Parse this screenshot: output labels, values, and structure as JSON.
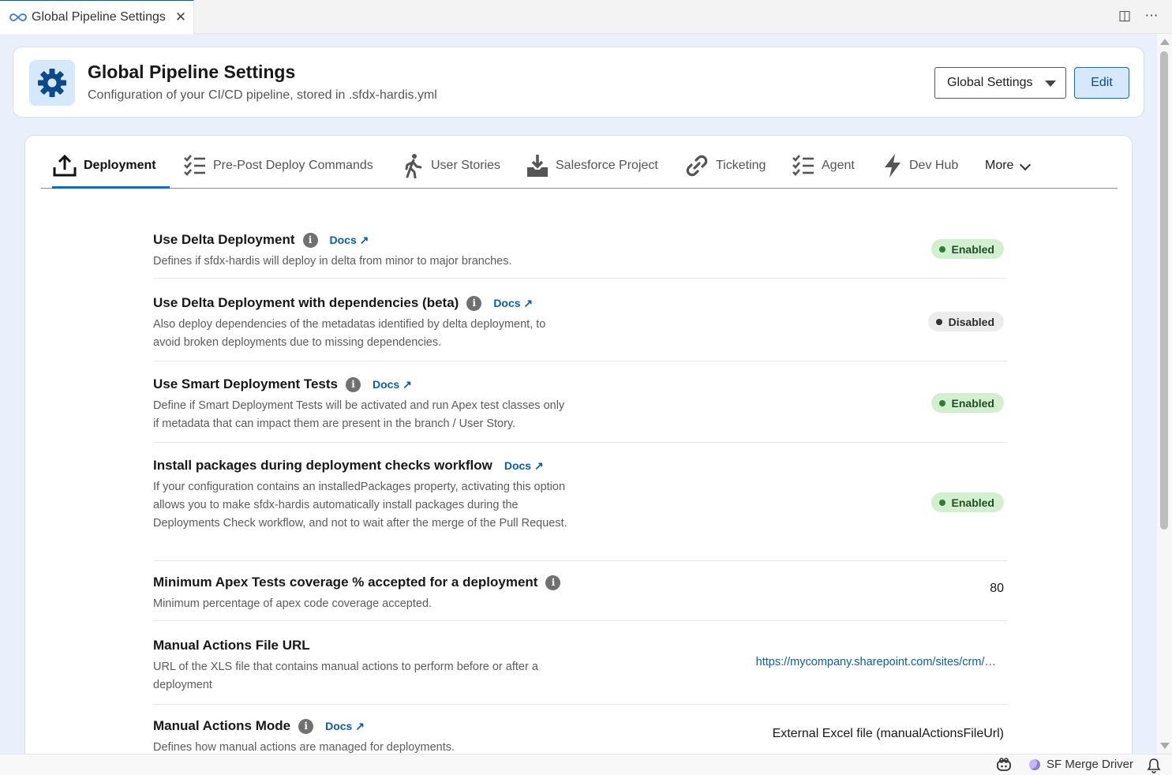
{
  "editor": {
    "tab_title": "Global Pipeline Settings",
    "close_glyph": "✕",
    "actions": {
      "split": "◫",
      "more": "⋯"
    }
  },
  "header": {
    "title": "Global Pipeline Settings",
    "subtitle": "Configuration of your CI/CD pipeline, stored in .sfdx-hardis.yml",
    "select_value": "Global Settings",
    "edit_label": "Edit"
  },
  "nav": {
    "tabs": [
      {
        "label": "Deployment",
        "icon": "upload-icon",
        "active": true
      },
      {
        "label": "Pre-Post Deploy Commands",
        "icon": "checklist-icon"
      },
      {
        "label": "User Stories",
        "icon": "walking-person-icon"
      },
      {
        "label": "Salesforce Project",
        "icon": "download-tray-icon"
      },
      {
        "label": "Ticketing",
        "icon": "link-icon"
      },
      {
        "label": "Agent",
        "icon": "checklist-icon"
      },
      {
        "label": "Dev Hub",
        "icon": "lightning-icon"
      }
    ],
    "more_label": "More"
  },
  "settings": [
    {
      "title": "Use Delta Deployment",
      "docs": "Docs ↗",
      "description": "Defines if sfdx-hardis will deploy in delta from minor to major branches.",
      "status": "Enabled"
    },
    {
      "title": "Use Delta Deployment with dependencies (beta)",
      "docs": "Docs ↗",
      "description": "Also deploy dependencies of the metadatas identified by delta deployment, to avoid broken deployments due to missing dependencies.",
      "status": "Disabled"
    },
    {
      "title": "Use Smart Deployment Tests",
      "docs": "Docs ↗",
      "description": "Define if Smart Deployment Tests will be activated and run Apex test classes only if metadata that can impact them are present in the branch / User Story.",
      "status": "Enabled"
    },
    {
      "title": "Install packages during deployment checks workflow",
      "docs": "Docs ↗",
      "description": "If your configuration contains an installedPackages property, activating this option allows you to make sfdx-hardis automatically install packages during the Deployments Check workflow, and not to wait after the merge of the Pull Request.",
      "status": "Enabled"
    },
    {
      "title": "Minimum Apex Tests coverage % accepted for a deployment",
      "description": "Minimum percentage of apex code coverage accepted.",
      "value": "80"
    },
    {
      "title": "Manual Actions File URL",
      "description": "URL of the XLS file that contains manual actions to perform before or after a deployment",
      "link": "https://mycompany.sharepoint.com/sites/crm/…"
    },
    {
      "title": "Manual Actions Mode",
      "docs": "Docs ↗",
      "description": "Defines how manual actions are managed for deployments.",
      "value": "External Excel file (manualActionsFileUrl)"
    }
  ],
  "statusbar": {
    "merge_driver": "SF Merge Driver"
  },
  "colors": {
    "accent": "#0070d2",
    "enabled_bg": "#d2f0d0",
    "disabled_bg": "#ececec",
    "link": "#0b5cab"
  }
}
